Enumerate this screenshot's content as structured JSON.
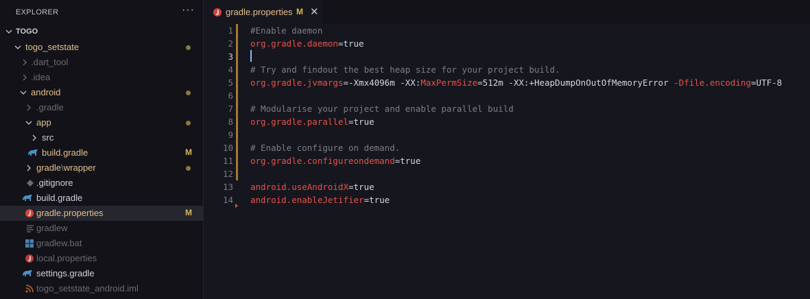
{
  "explorer": {
    "title": "EXPLORER",
    "more": "···",
    "root": "TOGO",
    "items": [
      {
        "label": "togo_setstate",
        "state": "mod"
      },
      {
        "label": ".dart_tool",
        "state": "ignored"
      },
      {
        "label": ".idea",
        "state": "ignored"
      },
      {
        "label": "android",
        "state": "mod"
      },
      {
        "label": ".gradle",
        "state": "ignored"
      },
      {
        "label": "app",
        "state": "mod"
      },
      {
        "label": "src",
        "state": "normal"
      },
      {
        "label": "build.gradle",
        "state": "mod",
        "badge": "M"
      },
      {
        "label": "gradle",
        "sep": "\\",
        "label2": "wrapper",
        "state": "mod"
      },
      {
        "label": ".gitignore",
        "state": "normal"
      },
      {
        "label": "build.gradle",
        "state": "normal"
      },
      {
        "label": "gradle.properties",
        "state": "mod",
        "badge": "M"
      },
      {
        "label": "gradlew",
        "state": "ignored"
      },
      {
        "label": "gradlew.bat",
        "state": "ignored"
      },
      {
        "label": "local.properties",
        "state": "ignored"
      },
      {
        "label": "settings.gradle",
        "state": "normal"
      },
      {
        "label": "togo_setstate_android.iml",
        "state": "ignored"
      }
    ]
  },
  "tab": {
    "label": "gradle.properties",
    "modified": "M",
    "close": "✕"
  },
  "colors": {
    "accent_modified": "#e2c08d",
    "badge": "#d7b655",
    "key": "#e5534b",
    "comment": "#7d7d86",
    "gitbar": "#a57b2c"
  },
  "editor": {
    "line_numbers": [
      "1",
      "2",
      "3",
      "4",
      "5",
      "6",
      "7",
      "8",
      "9",
      "10",
      "11",
      "12",
      "13",
      "14"
    ],
    "lines": [
      {
        "comment": "#Enable daemon"
      },
      {
        "key": "org.gradle.daemon",
        "eq": "=",
        "val": "true"
      },
      {
        "blank": ""
      },
      {
        "comment": "# Try and findout the best heap size for your project build."
      },
      {
        "key": "org.gradle.jvmargs",
        "eq": "=",
        "p1": "-Xmx4096m -XX:",
        "k2": "MaxPermSize",
        "p2": "=512m -XX:+HeapDumpOnOutOfMemoryError ",
        "k3": "-Dfile.encoding",
        "p3": "=UTF-8"
      },
      {
        "blank": ""
      },
      {
        "comment": "# Modularise your project and enable parallel build"
      },
      {
        "key": "org.gradle.parallel",
        "eq": "=",
        "val": "true"
      },
      {
        "blank": ""
      },
      {
        "comment": "# Enable configure on demand."
      },
      {
        "key": "org.gradle.configureondemand",
        "eq": "=",
        "val": "true"
      },
      {
        "blank": ""
      },
      {
        "key": "android.useAndroidX",
        "eq": "=",
        "val": "true"
      },
      {
        "key": "android.enableJetifier",
        "eq": "=",
        "val": "true"
      }
    ]
  }
}
